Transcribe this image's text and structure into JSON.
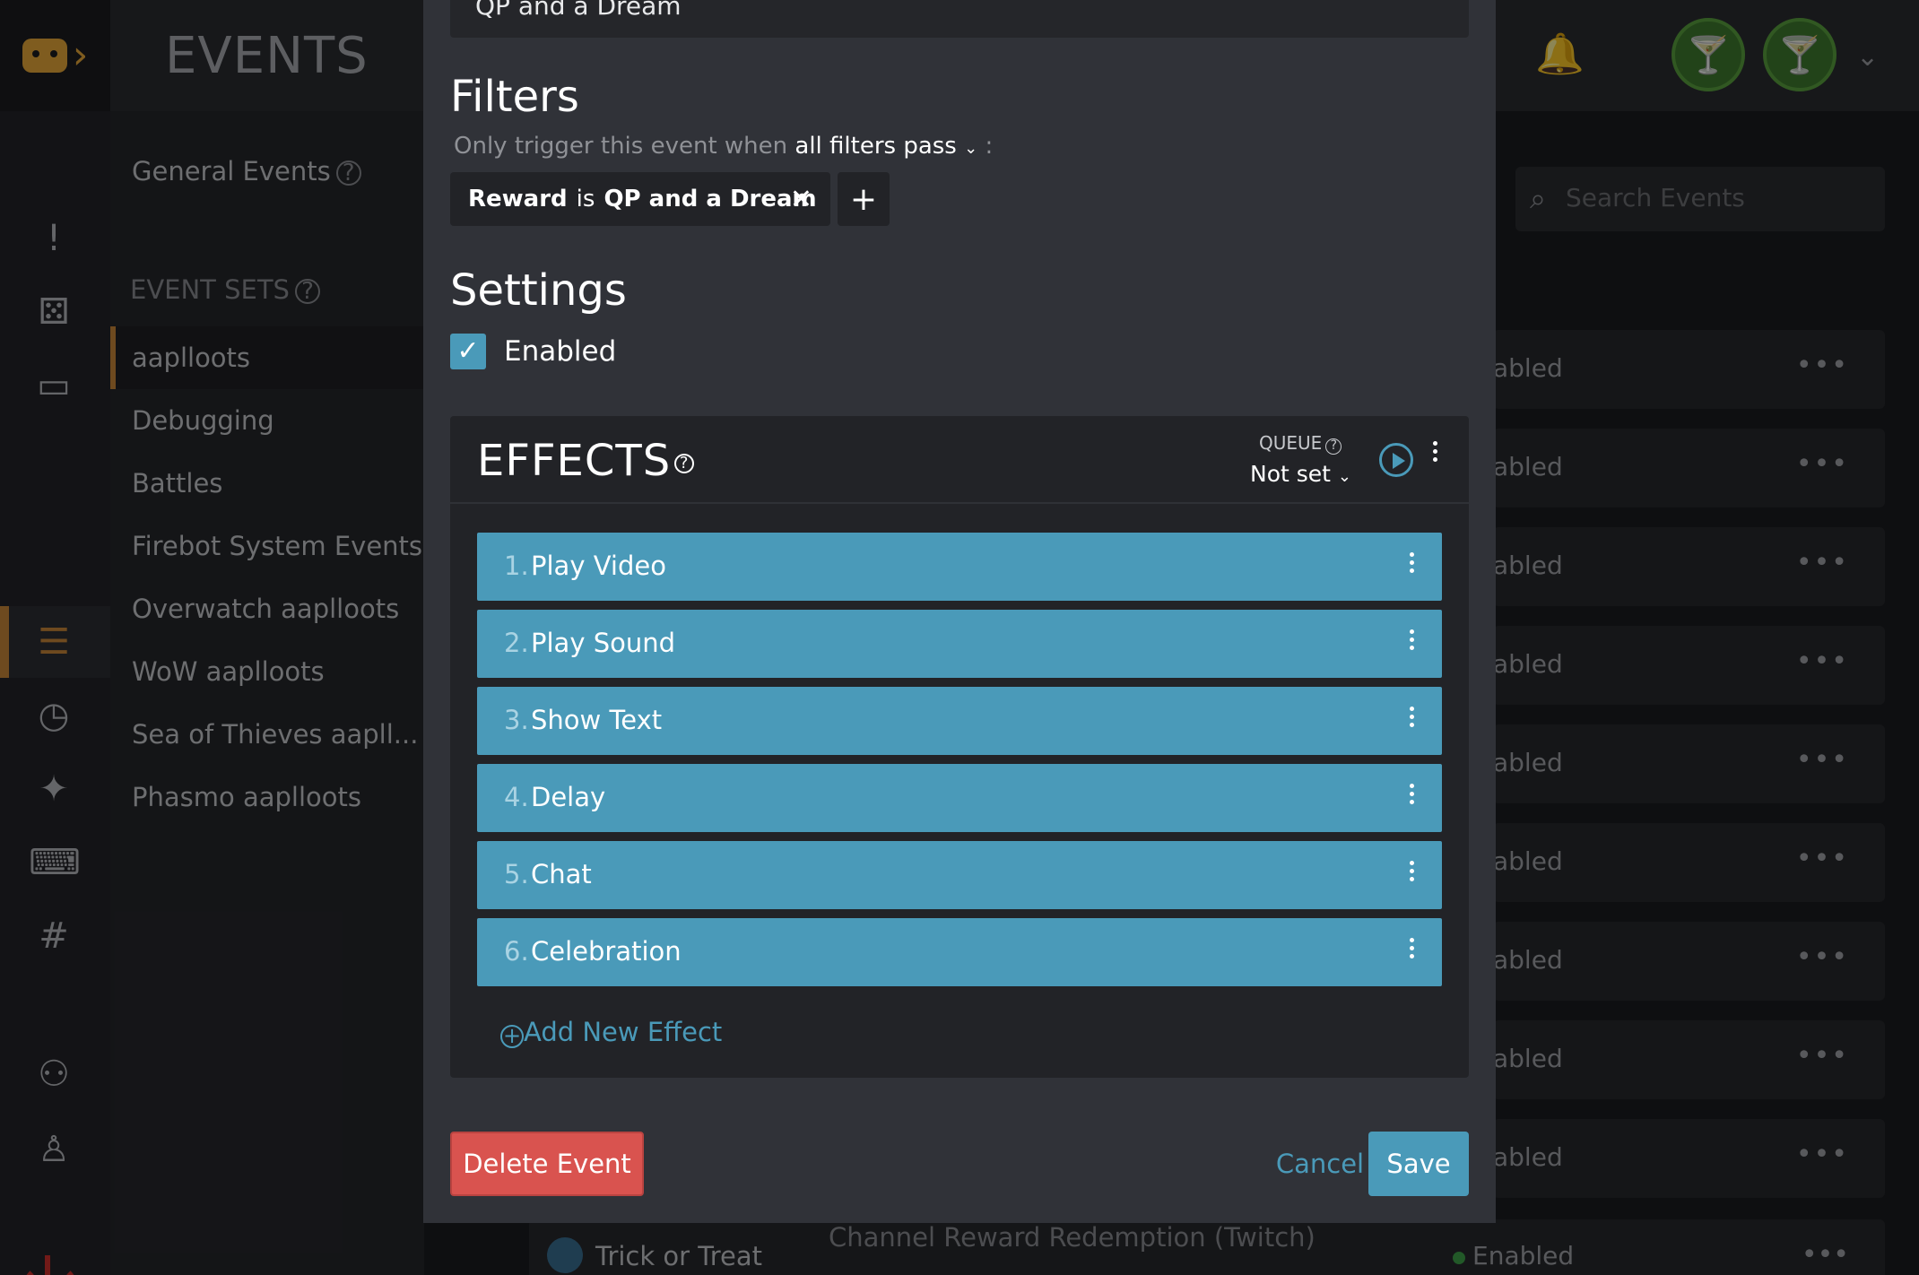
{
  "app": {
    "title": "EVENTS"
  },
  "side": {
    "general_events": "General Events",
    "event_sets_header": "EVENT SETS",
    "sets": [
      "aaplloots",
      "Debugging",
      "Battles",
      "Firebot System Events",
      "Overwatch aaplloots",
      "WoW aaplloots",
      "Sea of Thieves aapll...",
      "Phasmo aaplloots"
    ]
  },
  "search": {
    "placeholder": "Search Events"
  },
  "rows": {
    "status_partial": "abled",
    "count": 9
  },
  "bottom_row": {
    "name": "Trick or Treat",
    "type": "Channel Reward Redemption (Twitch)",
    "status": "Enabled"
  },
  "modal": {
    "event_name": "QP and a Dream",
    "filters": {
      "title": "Filters",
      "prefix": "Only trigger this event when",
      "mode": "all filters pass",
      "suffix": ":",
      "pill": {
        "field": "Reward",
        "op": "is",
        "value": "QP and a Dream"
      }
    },
    "settings": {
      "title": "Settings",
      "enabled_label": "Enabled"
    },
    "effects": {
      "title": "EFFECTS",
      "queue_label": "QUEUE",
      "queue_value": "Not set",
      "items": [
        {
          "num": "1.",
          "label": "Play Video"
        },
        {
          "num": "2.",
          "label": "Play Sound"
        },
        {
          "num": "3.",
          "label": "Show Text"
        },
        {
          "num": "4.",
          "label": "Delay"
        },
        {
          "num": "5.",
          "label": "Chat"
        },
        {
          "num": "6.",
          "label": "Celebration"
        }
      ],
      "add_label": "Add New Effect"
    },
    "buttons": {
      "delete": "Delete Event",
      "cancel": "Cancel",
      "save": "Save"
    }
  },
  "colors": {
    "accent": "#4a9ab9",
    "danger": "#d9534f",
    "brand": "#e8a83a"
  }
}
